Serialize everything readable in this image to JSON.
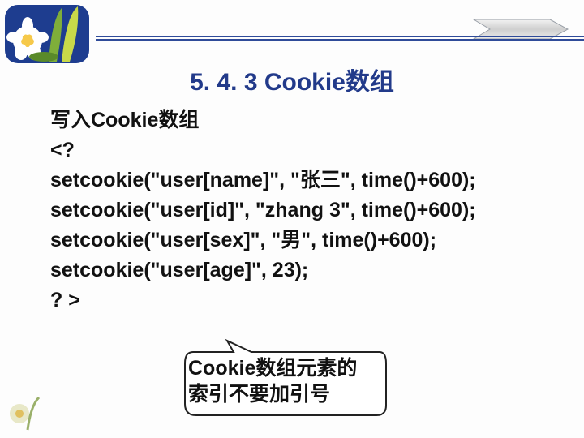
{
  "title": "5. 4. 3 Cookie数组",
  "subtitle": "写入Cookie数组",
  "code_lines": [
    "<?",
    "setcookie(\"user[name]\", \"张三\", time()+600);",
    "setcookie(\"user[id]\", \"zhang 3\", time()+600);",
    "setcookie(\"user[sex]\", \"男\", time()+600);",
    "setcookie(\"user[age]\", 23);",
    "? >"
  ],
  "callout_line1": "Cookie数组元素的",
  "callout_line2": "索引不要加引号",
  "colors": {
    "accent": "#2f4b99",
    "title": "#223a8a"
  }
}
